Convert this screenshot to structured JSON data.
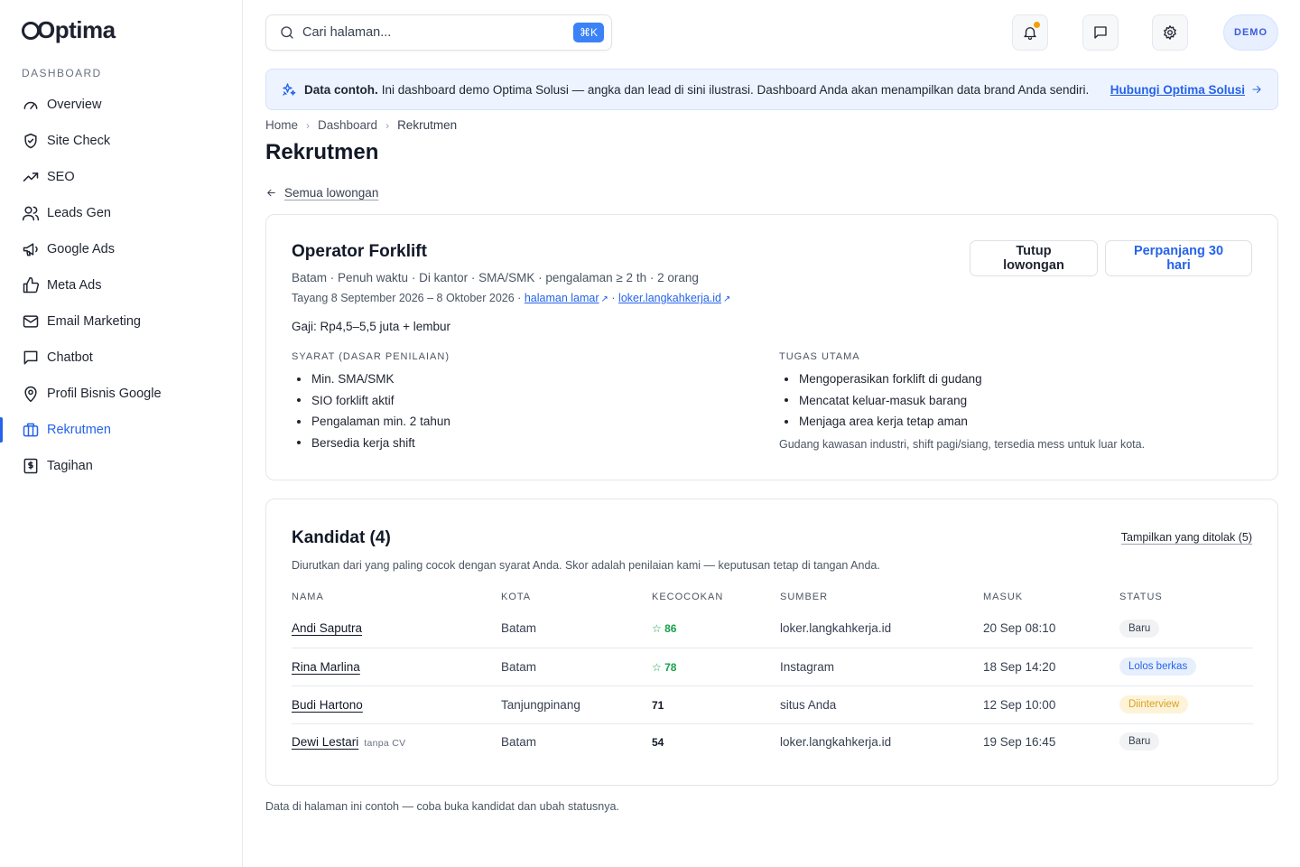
{
  "app": {
    "logo_text": "Optima"
  },
  "sidebar": {
    "section_title": "DASHBOARD",
    "items": [
      {
        "label": "Overview",
        "icon": "gauge-icon"
      },
      {
        "label": "Site Check",
        "icon": "shield-check-icon"
      },
      {
        "label": "SEO",
        "icon": "trending-up-icon"
      },
      {
        "label": "Leads Gen",
        "icon": "users-icon"
      },
      {
        "label": "Google Ads",
        "icon": "megaphone-icon"
      },
      {
        "label": "Meta Ads",
        "icon": "thumbs-up-icon"
      },
      {
        "label": "Email Marketing",
        "icon": "mail-icon"
      },
      {
        "label": "Chatbot",
        "icon": "chat-icon"
      },
      {
        "label": "Profil Bisnis Google",
        "icon": "map-pin-icon"
      },
      {
        "label": "Rekrutmen",
        "icon": "briefcase-icon",
        "active": true
      },
      {
        "label": "Tagihan",
        "icon": "receipt-icon"
      }
    ],
    "active_color": "#2563eb"
  },
  "header": {
    "search_placeholder": "Cari halaman...",
    "shortcut": "⌘K",
    "demo_label": "DEMO",
    "notification_dot_color": "#f59e0b"
  },
  "banner": {
    "bold": "Data contoh.",
    "text": "Ini dashboard demo Optima Solusi — angka dan lead di sini ilustrasi. Dashboard Anda akan menampilkan data brand Anda sendiri.",
    "link": "Hubungi Optima Solusi"
  },
  "breadcrumb": {
    "items": [
      "Home",
      "Dashboard",
      "Rekrutmen"
    ]
  },
  "page_title": "Rekrutmen",
  "back_link": "Semua lowongan",
  "job": {
    "title": "Operator Forklift",
    "meta": "Batam · Penuh waktu · Di kantor · SMA/SMK · pengalaman ≥ 2 th · 2 orang",
    "dates": "Tayang 8 September 2026 – 8 Oktober 2026 ·",
    "apply_link": "halaman lamar",
    "portal_link": "loker.langkahkerja.id",
    "salary": "Gaji: Rp4,5–5,5 juta + lembur",
    "close_button": "Tutup lowongan",
    "extend_button": "Perpanjang 30 hari",
    "requirements_label": "SYARAT (DASAR PENILAIAN)",
    "requirements": [
      "Min. SMA/SMK",
      "SIO forklift aktif",
      "Pengalaman min. 2 tahun",
      "Bersedia kerja shift"
    ],
    "duties_label": "TUGAS UTAMA",
    "duties": [
      "Mengoperasikan forklift di gudang",
      "Mencatat keluar-masuk barang",
      "Menjaga area kerja tetap aman"
    ],
    "duty_note": "Gudang kawasan industri, shift pagi/siang, tersedia mess untuk luar kota."
  },
  "candidates": {
    "title": "Kandidat (4)",
    "show_rejected": "Tampilkan yang ditolak (5)",
    "description": "Diurutkan dari yang paling cocok dengan syarat Anda. Skor adalah penilaian kami — keputusan tetap di tangan Anda.",
    "columns": [
      "NAMA",
      "KOTA",
      "KECOCOKAN",
      "SUMBER",
      "MASUK",
      "STATUS"
    ],
    "rows": [
      {
        "name": "Andi Saputra",
        "note": "",
        "city": "Batam",
        "score": "86",
        "starred": true,
        "source": "loker.langkahkerja.id",
        "date": "20 Sep 08:10",
        "status": "Baru",
        "status_type": "baru"
      },
      {
        "name": "Rina Marlina",
        "note": "",
        "city": "Batam",
        "score": "78",
        "starred": true,
        "source": "Instagram",
        "date": "18 Sep 14:20",
        "status": "Lolos berkas",
        "status_type": "lolos"
      },
      {
        "name": "Budi Hartono",
        "note": "",
        "city": "Tanjungpinang",
        "score": "71",
        "starred": false,
        "source": "situs Anda",
        "date": "12 Sep 10:00",
        "status": "Diinterview",
        "status_type": "interview"
      },
      {
        "name": "Dewi Lestari",
        "note": "tanpa CV",
        "city": "Batam",
        "score": "54",
        "starred": false,
        "source": "loker.langkahkerja.id",
        "date": "19 Sep 16:45",
        "status": "Baru",
        "status_type": "baru"
      }
    ]
  },
  "footnote": "Data di halaman ini contoh — coba buka kandidat dan ubah statusnya."
}
